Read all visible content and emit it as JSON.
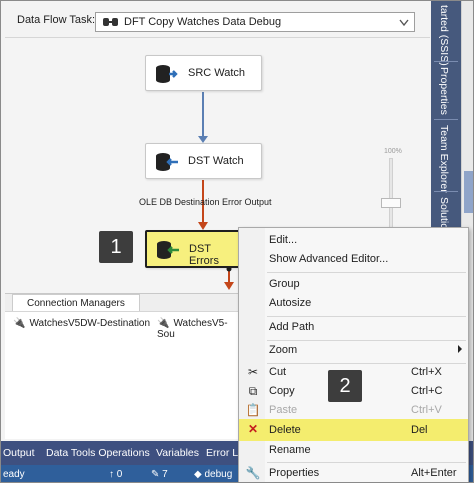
{
  "taskbar": {
    "label": "Data Flow Task:",
    "selected_task": "DFT Copy Watches Data Debug"
  },
  "canvas": {
    "components": [
      {
        "name": "SRC Watch",
        "icon": "source-icon"
      },
      {
        "name": "DST Watch",
        "icon": "destination-icon"
      },
      {
        "name": "DST Errors",
        "icon": "destination-icon",
        "selected": true
      }
    ],
    "error_output_label": "OLE DB Destination Error Output",
    "zoom_label": "100%"
  },
  "callouts": {
    "one": "1",
    "two": "2"
  },
  "connection_managers": {
    "tab_label": "Connection Managers",
    "items": [
      "WatchesV5DW-Destination",
      "WatchesV5-Sou"
    ]
  },
  "right_tabs": [
    "tarted (SSIS)",
    "Properties",
    "Team Explorer",
    "Solutio"
  ],
  "bottom_tabs": [
    "Output",
    "Data Tools Operations",
    "Variables",
    "Error Li"
  ],
  "status": {
    "left": "eady",
    "up_count": "0",
    "pencil_count": "7",
    "branch": "debug"
  },
  "context_menu": {
    "items": [
      {
        "label": "Edit...",
        "shortcut": ""
      },
      {
        "label": "Show Advanced Editor...",
        "shortcut": ""
      },
      {
        "label": "Group",
        "shortcut": ""
      },
      {
        "label": "Autosize",
        "shortcut": ""
      },
      {
        "label": "Add Path",
        "shortcut": ""
      },
      {
        "label": "Zoom",
        "shortcut": ""
      },
      {
        "label": "Cut",
        "shortcut": "Ctrl+X"
      },
      {
        "label": "Copy",
        "shortcut": "Ctrl+C"
      },
      {
        "label": "Paste",
        "shortcut": "Ctrl+V",
        "disabled": true
      },
      {
        "label": "Delete",
        "shortcut": "Del",
        "highlighted": true
      },
      {
        "label": "Rename",
        "shortcut": ""
      },
      {
        "label": "Properties",
        "shortcut": "Alt+Enter"
      }
    ]
  },
  "colors": {
    "highlight": "#f4ed6e",
    "right_strip": "#46597d",
    "tab_bar": "#3e5080",
    "status_bar": "#2f5f9b",
    "flow_arrow": "#5b7fb3",
    "error_arrow": "#c4461a"
  }
}
